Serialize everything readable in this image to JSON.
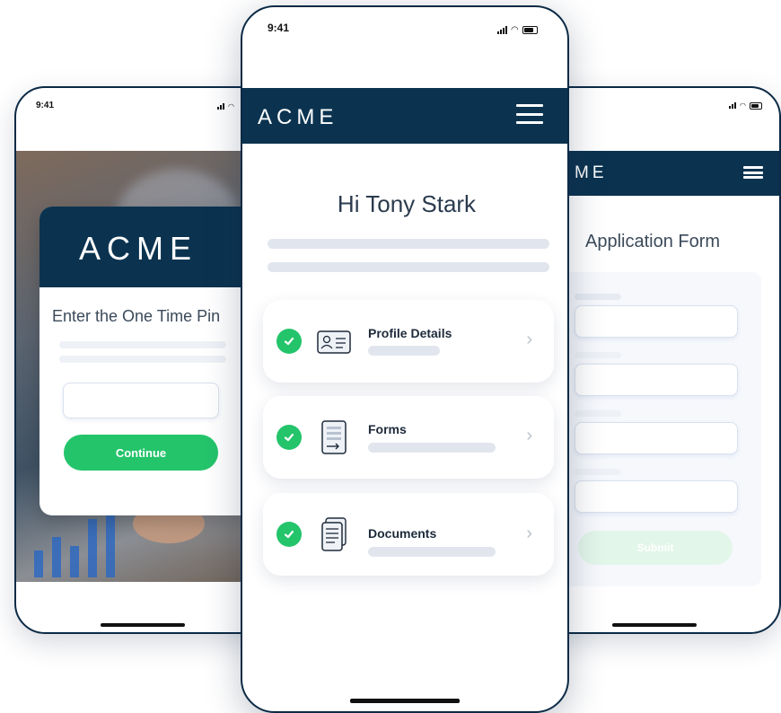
{
  "colors": {
    "navy": "#0b3350",
    "green": "#24c46b",
    "skeleton": "#e1e6ee"
  },
  "left_phone": {
    "time": "9:41",
    "logo": "ACME",
    "heading": "Enter the One Time Pin",
    "pin_input": "",
    "continue_button": "Continue"
  },
  "center_phone": {
    "time": "9:41",
    "logo": "ACME",
    "menu_icon": "hamburger-icon",
    "greeting": "Hi Tony Stark",
    "items": [
      {
        "title": "Profile Details",
        "icon": "id-card-icon",
        "status": "completed"
      },
      {
        "title": "Forms",
        "icon": "form-icon",
        "status": "completed"
      },
      {
        "title": "Documents",
        "icon": "documents-icon",
        "status": "completed"
      }
    ]
  },
  "right_phone": {
    "logo": "ME",
    "heading": "Application Form",
    "submit_button": "Submit"
  }
}
